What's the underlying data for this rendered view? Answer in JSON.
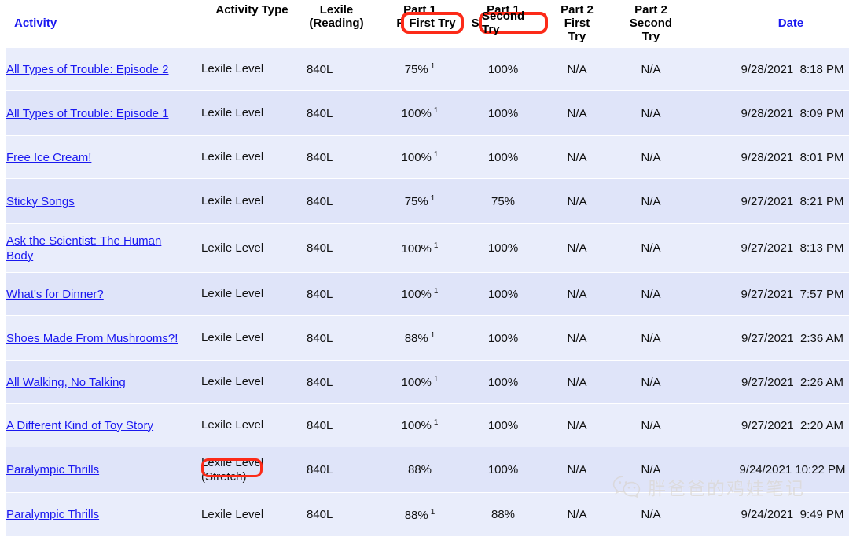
{
  "table": {
    "columns": [
      {
        "label": "Activity",
        "is_link": true,
        "align": "left"
      },
      {
        "label": "Activity Type",
        "is_link": false,
        "align": "center"
      },
      {
        "label": "Lexile\n(Reading)",
        "is_link": false,
        "align": "center"
      },
      {
        "label": "Part 1\nFirst Try",
        "is_link": false,
        "align": "center"
      },
      {
        "label": "Part 1\nSecond Try",
        "is_link": false,
        "align": "center"
      },
      {
        "label": "Part 2\nFirst\nTry",
        "is_link": false,
        "align": "center"
      },
      {
        "label": "Part 2\nSecond\nTry",
        "is_link": false,
        "align": "center"
      },
      {
        "label": "Date",
        "is_link": true,
        "align": "center"
      }
    ],
    "rows": [
      {
        "activity": "All Types of Trouble: Episode 2",
        "activity_type": "Lexile Level",
        "activity_type_note": "",
        "lexile": "840L",
        "p1_first": "75%",
        "p1_first_sup": "1",
        "p1_second": "100%",
        "p2_first": "N/A",
        "p2_second": "N/A",
        "date": "9/28/2021  8:18 PM"
      },
      {
        "activity": "All Types of Trouble: Episode 1",
        "activity_type": "Lexile Level",
        "activity_type_note": "",
        "lexile": "840L",
        "p1_first": "100%",
        "p1_first_sup": "1",
        "p1_second": "100%",
        "p2_first": "N/A",
        "p2_second": "N/A",
        "date": "9/28/2021  8:09 PM"
      },
      {
        "activity": "Free Ice Cream!",
        "activity_type": "Lexile Level",
        "activity_type_note": "",
        "lexile": "840L",
        "p1_first": "100%",
        "p1_first_sup": "1",
        "p1_second": "100%",
        "p2_first": "N/A",
        "p2_second": "N/A",
        "date": "9/28/2021  8:01 PM"
      },
      {
        "activity": "Sticky Songs",
        "activity_type": "Lexile Level",
        "activity_type_note": "",
        "lexile": "840L",
        "p1_first": "75%",
        "p1_first_sup": "1",
        "p1_second": "75%",
        "p2_first": "N/A",
        "p2_second": "N/A",
        "date": "9/27/2021  8:21 PM"
      },
      {
        "activity": "Ask the Scientist: The Human Body",
        "activity_type": "Lexile Level",
        "activity_type_note": "",
        "lexile": "840L",
        "p1_first": "100%",
        "p1_first_sup": "1",
        "p1_second": "100%",
        "p2_first": "N/A",
        "p2_second": "N/A",
        "date": "9/27/2021  8:13 PM"
      },
      {
        "activity": "What's for Dinner?",
        "activity_type": "Lexile Level",
        "activity_type_note": "",
        "lexile": "840L",
        "p1_first": "100%",
        "p1_first_sup": "1",
        "p1_second": "100%",
        "p2_first": "N/A",
        "p2_second": "N/A",
        "date": "9/27/2021  7:57 PM"
      },
      {
        "activity": "Shoes Made From Mushrooms?!",
        "activity_type": "Lexile Level",
        "activity_type_note": "",
        "lexile": "840L",
        "p1_first": "88%",
        "p1_first_sup": "1",
        "p1_second": "100%",
        "p2_first": "N/A",
        "p2_second": "N/A",
        "date": "9/27/2021  2:36 AM"
      },
      {
        "activity": "All Walking, No Talking",
        "activity_type": "Lexile Level",
        "activity_type_note": "",
        "lexile": "840L",
        "p1_first": "100%",
        "p1_first_sup": "1",
        "p1_second": "100%",
        "p2_first": "N/A",
        "p2_second": "N/A",
        "date": "9/27/2021  2:26 AM"
      },
      {
        "activity": "A Different Kind of Toy Story",
        "activity_type": "Lexile Level",
        "activity_type_note": "",
        "lexile": "840L",
        "p1_first": "100%",
        "p1_first_sup": "1",
        "p1_second": "100%",
        "p2_first": "N/A",
        "p2_second": "N/A",
        "date": "9/27/2021  2:20 AM"
      },
      {
        "activity": "Paralympic Thrills",
        "activity_type": "Lexile Level",
        "activity_type_note": "(Stretch)",
        "lexile": "840L",
        "p1_first": "88%",
        "p1_first_sup": "",
        "p1_second": "100%",
        "p2_first": "N/A",
        "p2_second": "N/A",
        "date": "9/24/2021 10:22 PM"
      },
      {
        "activity": "Paralympic Thrills",
        "activity_type": "Lexile Level",
        "activity_type_note": "",
        "lexile": "840L",
        "p1_first": "88%",
        "p1_first_sup": "1",
        "p1_second": "88%",
        "p2_first": "N/A",
        "p2_second": "N/A",
        "date": "9/24/2021  9:49 PM"
      }
    ]
  },
  "annotations": {
    "color": "#fc2a18",
    "first_try": "First Try",
    "second_try": "Second Try",
    "stretch": "(Stretch)"
  },
  "watermark": {
    "text": "胖爸爸的鸡娃笔记",
    "logo": "wechat-icon"
  },
  "colors": {
    "link": "#1a18f0",
    "row_light": "#e9edfb",
    "row_dark": "#dfe4f9",
    "annotation_red": "#fc2a18"
  }
}
